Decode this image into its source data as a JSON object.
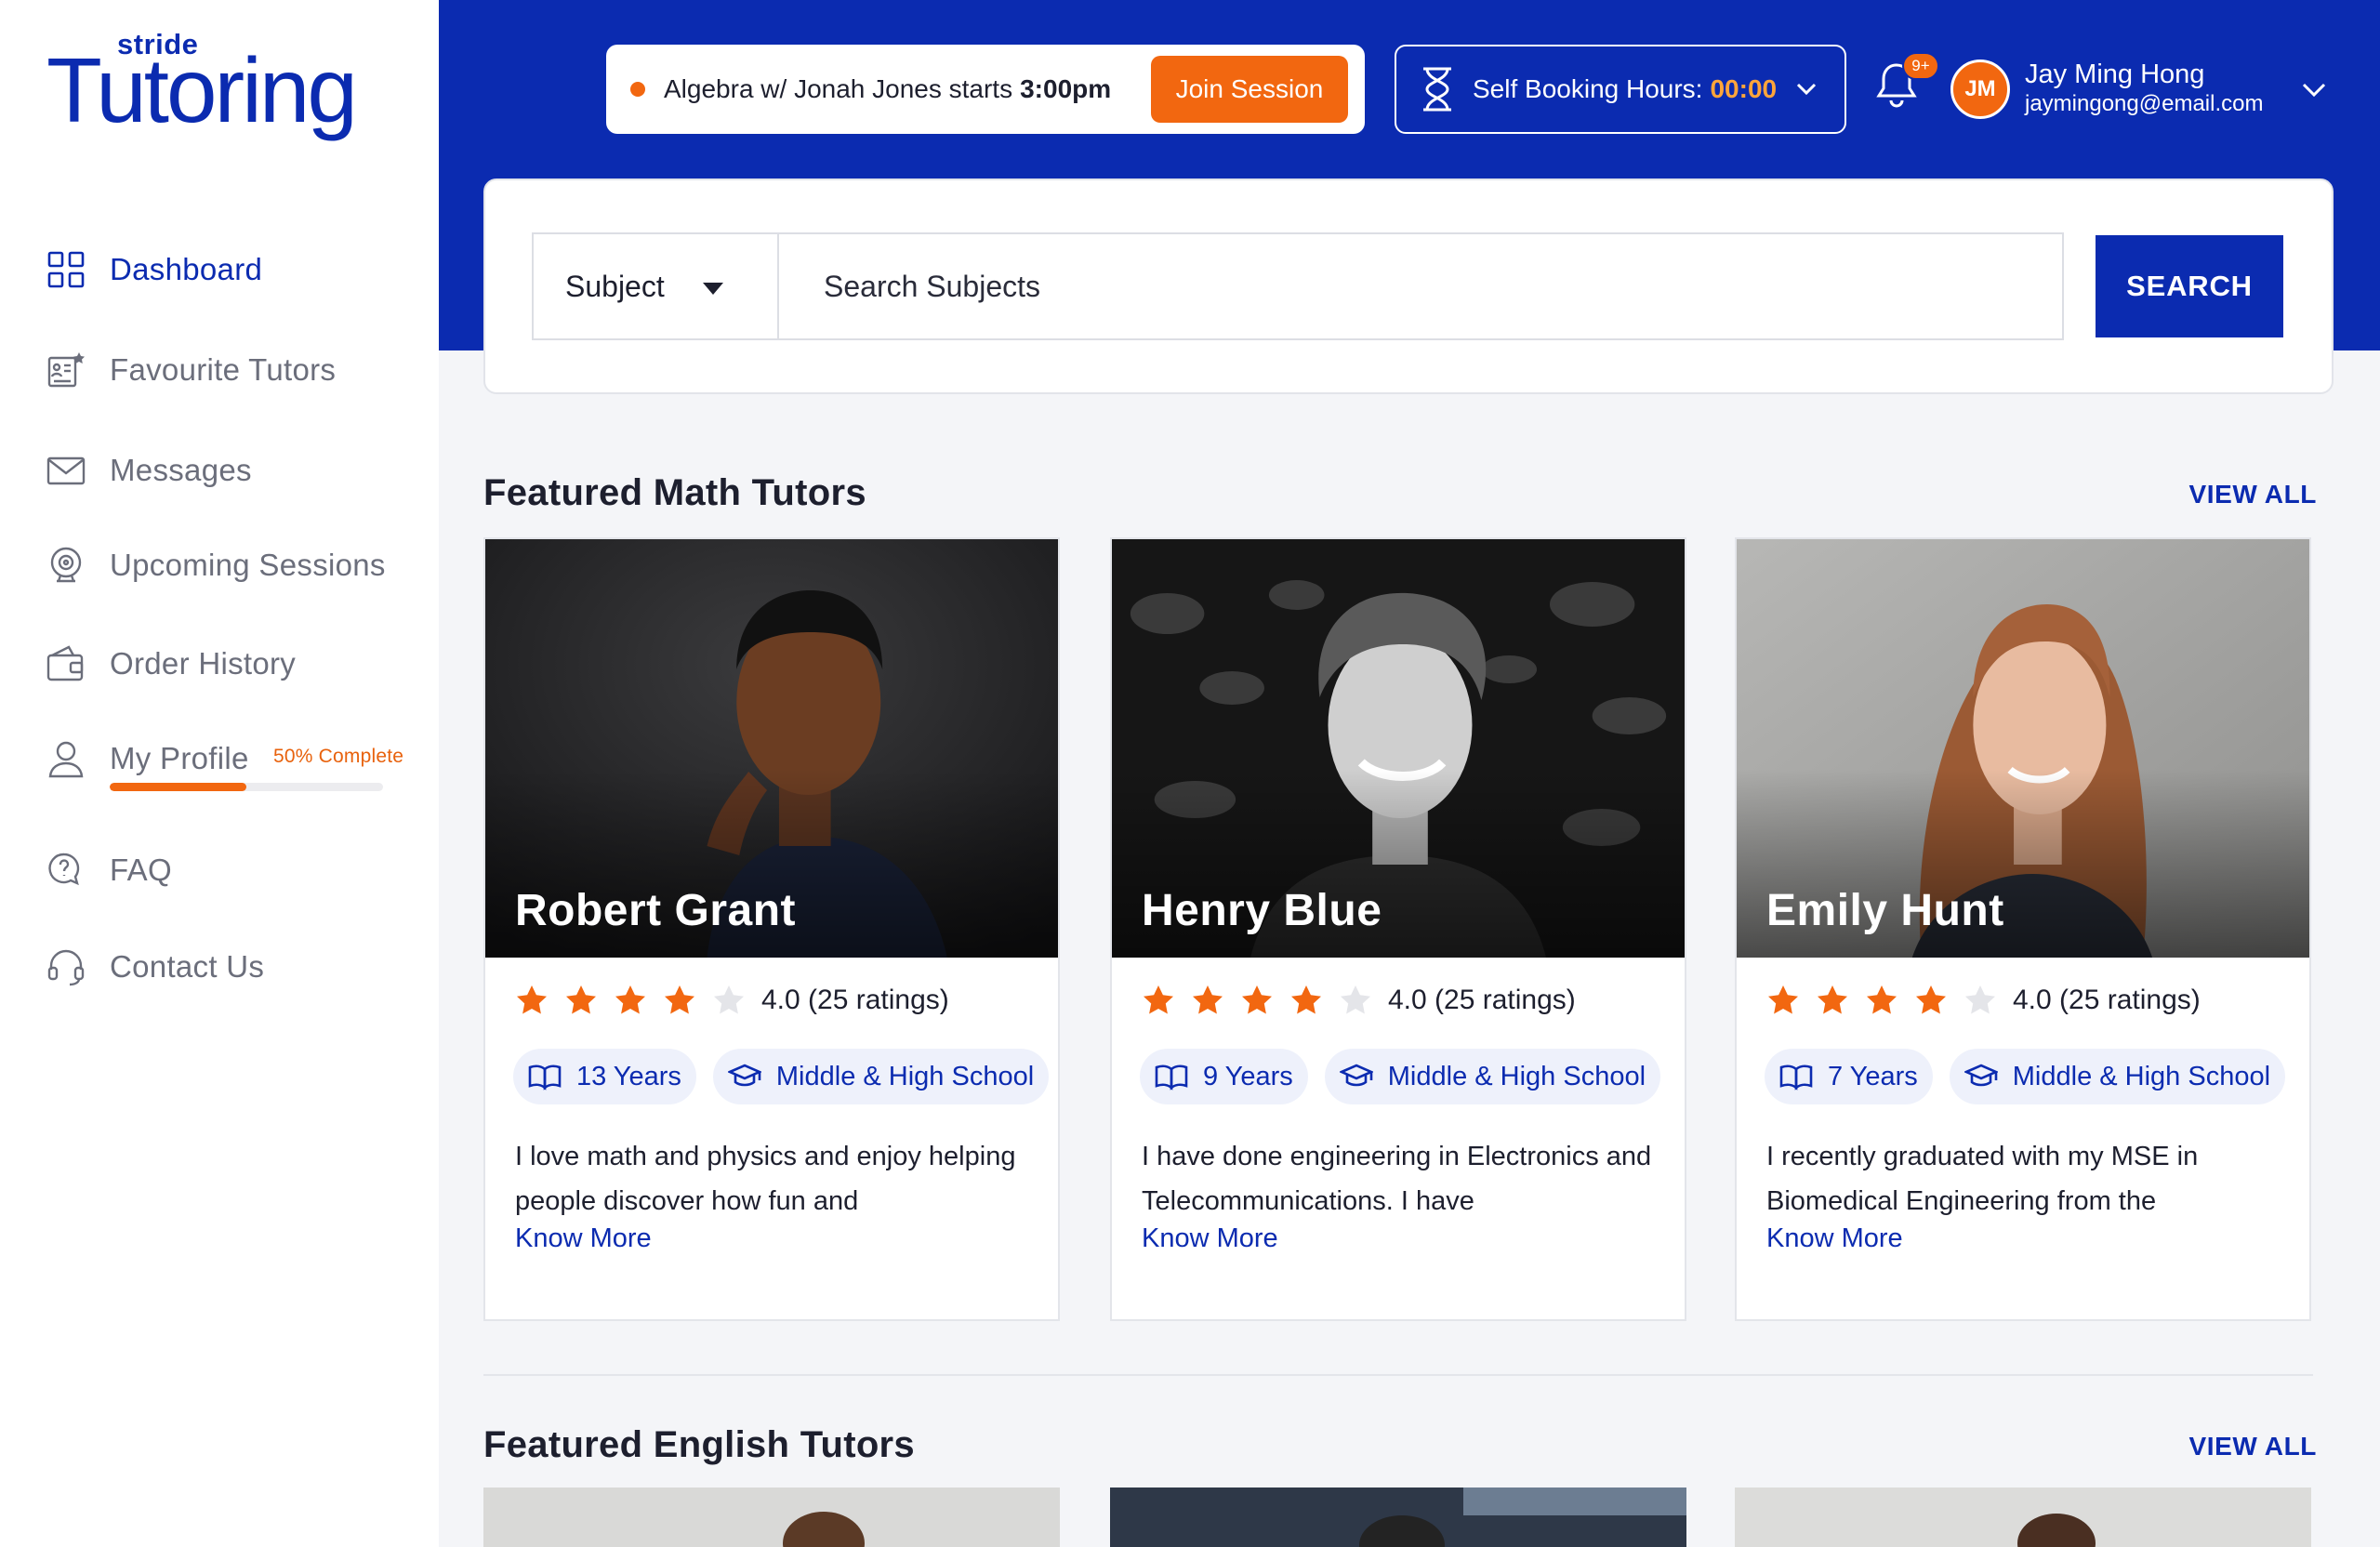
{
  "brand": {
    "stride": "stride",
    "tutoring": "Tutoring"
  },
  "sidebar": {
    "items": [
      {
        "label": "Dashboard",
        "icon": "grid-icon"
      },
      {
        "label": "Favourite Tutors",
        "icon": "favourite-list-icon"
      },
      {
        "label": "Messages",
        "icon": "envelope-icon"
      },
      {
        "label": "Upcoming Sessions",
        "icon": "webcam-icon"
      },
      {
        "label": "Order History",
        "icon": "wallet-icon"
      },
      {
        "label": "My Profile",
        "icon": "user-icon"
      },
      {
        "label": "FAQ",
        "icon": "chat-question-icon"
      },
      {
        "label": "Contact Us",
        "icon": "headset-icon"
      }
    ],
    "profile_completion": {
      "text": "50% Complete",
      "fraction": 0.5
    }
  },
  "header": {
    "session": {
      "text": "Algebra w/ Jonah Jones starts",
      "time": "3:00pm",
      "button": "Join Session"
    },
    "booking": {
      "label": "Self Booking Hours:",
      "value": "00:00"
    },
    "notifications": {
      "badge": "9+"
    },
    "user": {
      "initials": "JM",
      "name": "Jay Ming Hong",
      "email": "jaymingong@email.com"
    }
  },
  "search": {
    "subject_label": "Subject",
    "placeholder": "Search Subjects",
    "button": "SEARCH"
  },
  "math": {
    "title": "Featured Math Tutors",
    "view_all": "VIEW ALL",
    "tutors": [
      {
        "name": "Robert Grant",
        "rating": 4,
        "rating_text": "4.0 (25 ratings)",
        "experience": "13 Years",
        "level": "Middle & High School",
        "bio": "I love math and physics and enjoy helping people discover how fun and",
        "more": "Know More"
      },
      {
        "name": "Henry Blue",
        "rating": 4,
        "rating_text": "4.0 (25 ratings)",
        "experience": "9 Years",
        "level": "Middle & High School",
        "bio": "I have done engineering in Electronics and Telecommunications. I have",
        "more": "Know More"
      },
      {
        "name": "Emily Hunt",
        "rating": 4,
        "rating_text": "4.0 (25 ratings)",
        "experience": "7 Years",
        "level": "Middle & High School",
        "bio": "I recently graduated with my MSE in Biomedical Engineering from the",
        "more": "Know More"
      }
    ]
  },
  "english": {
    "title": "Featured English Tutors",
    "view_all": "VIEW ALL"
  },
  "colors": {
    "brand_blue": "#0b2bb0",
    "accent_orange": "#f26710",
    "star_empty": "#e4e5e9"
  }
}
